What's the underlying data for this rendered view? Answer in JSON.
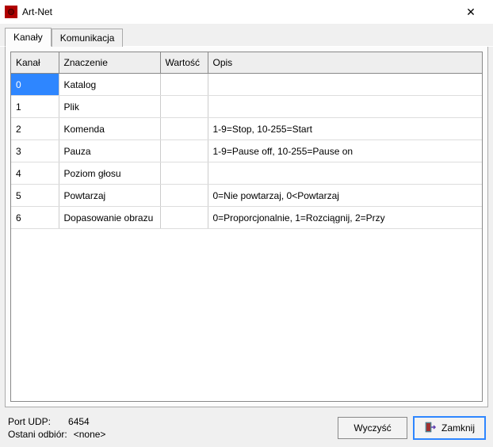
{
  "window": {
    "title": "Art-Net"
  },
  "tabs": {
    "items": [
      {
        "label": "Kanały",
        "active": true
      },
      {
        "label": "Komunikacja",
        "active": false
      }
    ]
  },
  "table": {
    "headers": {
      "kanal": "Kanał",
      "znaczenie": "Znaczenie",
      "wartosc": "Wartość",
      "opis": "Opis"
    },
    "rows": [
      {
        "kanal": "0",
        "znaczenie": "Katalog",
        "wartosc": "",
        "opis": ""
      },
      {
        "kanal": "1",
        "znaczenie": "Plik",
        "wartosc": "",
        "opis": ""
      },
      {
        "kanal": "2",
        "znaczenie": "Komenda",
        "wartosc": "",
        "opis": "1-9=Stop, 10-255=Start"
      },
      {
        "kanal": "3",
        "znaczenie": "Pauza",
        "wartosc": "",
        "opis": "1-9=Pause off, 10-255=Pause on"
      },
      {
        "kanal": "4",
        "znaczenie": "Poziom głosu",
        "wartosc": "",
        "opis": ""
      },
      {
        "kanal": "5",
        "znaczenie": "Powtarzaj",
        "wartosc": "",
        "opis": "0=Nie powtarzaj, 0<Powtarzaj"
      },
      {
        "kanal": "6",
        "znaczenie": "Dopasowanie obrazu",
        "wartosc": "",
        "opis": "0=Proporcjonalnie, 1=Rozciągnij, 2=Przy"
      }
    ],
    "selected_cell": {
      "row": 0,
      "col": "kanal"
    }
  },
  "status": {
    "port_label": "Port UDP:",
    "port_value": "6454",
    "last_label": "Ostani odbiór:",
    "last_value": "<none>"
  },
  "buttons": {
    "clear": "Wyczyść",
    "close": "Zamknij"
  }
}
